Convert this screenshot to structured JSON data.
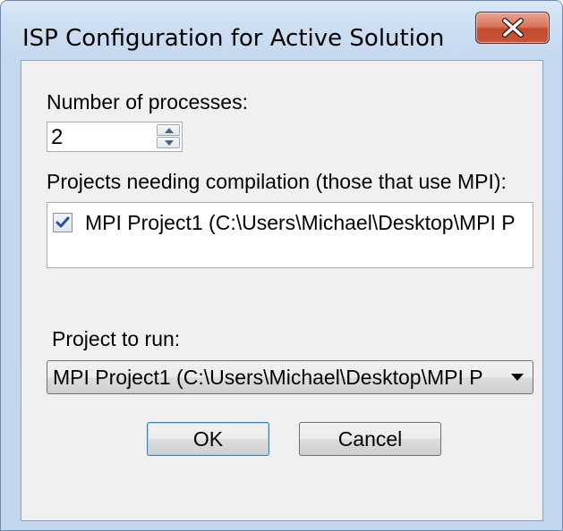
{
  "window": {
    "title": "ISP Configuration for Active Solution",
    "close_icon": "close-icon"
  },
  "processes": {
    "label": "Number of processes:",
    "value": "2"
  },
  "compilation": {
    "label": "Projects needing compilation (those that use MPI):",
    "items": [
      {
        "label": "MPI Project1 (C:\\Users\\Michael\\Desktop\\MPI P",
        "checked": true
      }
    ]
  },
  "run": {
    "label": "Project to run:",
    "selected": "MPI Project1 (C:\\Users\\Michael\\Desktop\\MPI P"
  },
  "buttons": {
    "ok": "OK",
    "cancel": "Cancel"
  }
}
